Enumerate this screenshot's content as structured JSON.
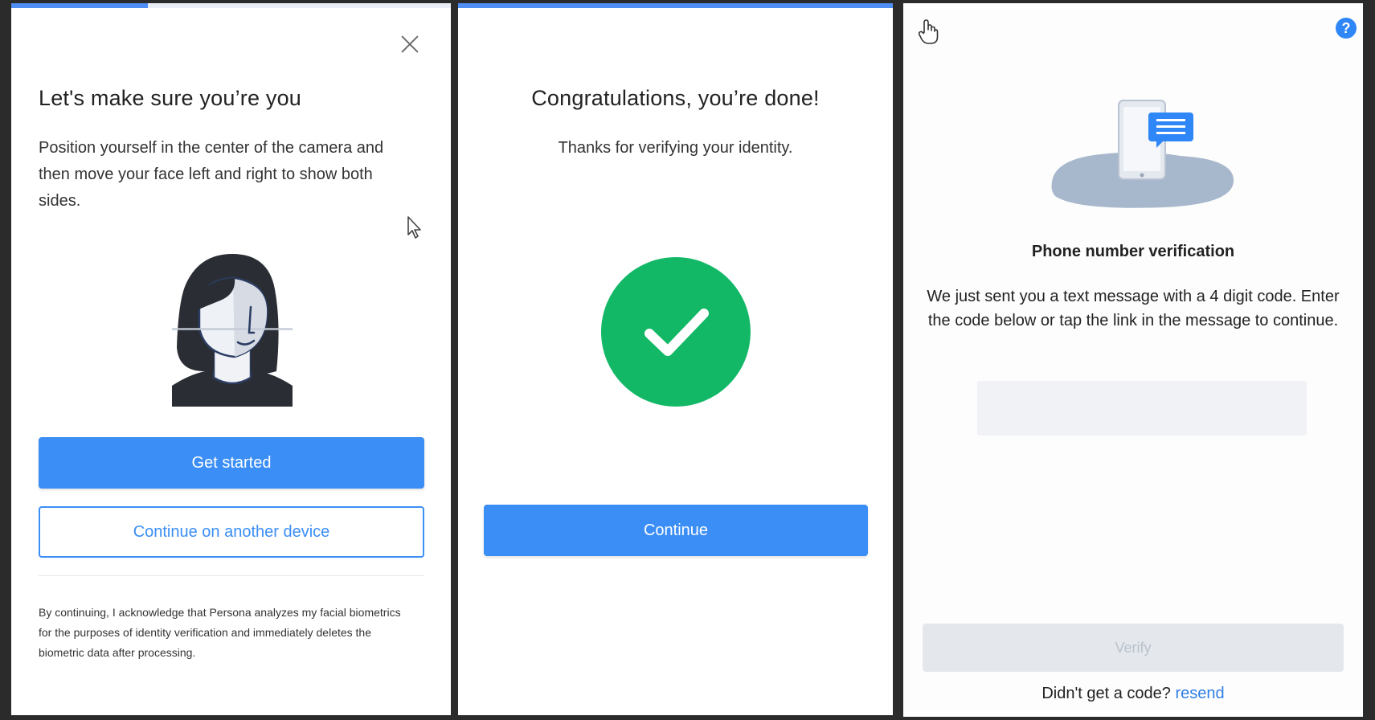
{
  "panel1": {
    "progress": 0.31,
    "title": "Let's make sure you’re you",
    "instructions": "Position yourself in the center of the camera and then move your face left and right to show both sides.",
    "primary_button": "Get started",
    "secondary_button": "Continue on another device",
    "legal": "By continuing, I acknowledge that Persona analyzes my facial biometrics for the purposes of identity verification and immediately deletes the biometric data after processing.",
    "icons": {
      "close": "close-icon",
      "cursor": "mouse-pointer-icon",
      "illustration": "face-illustration"
    }
  },
  "panel2": {
    "progress": 1.0,
    "title": "Congratulations, you’re done!",
    "subtitle": "Thanks for verifying your identity.",
    "button": "Continue",
    "colors": {
      "success": "#12b866"
    },
    "icons": {
      "status": "checkmark-circle-icon"
    }
  },
  "panel3": {
    "title": "Phone number verification",
    "message": "We just sent you a text message with a 4 digit code. Enter the code below or tap the link in the message to continue.",
    "code_value": "",
    "verify_button": "Verify",
    "resend_prompt": "Didn't get a code?",
    "resend_link": "resend",
    "help": "?",
    "icons": {
      "hand": "hand-pointer-icon",
      "help": "help-icon",
      "illustration": "phone-message-illustration"
    }
  },
  "colors": {
    "accent": "#3b8ef5",
    "progress": "#4f8ef2"
  }
}
